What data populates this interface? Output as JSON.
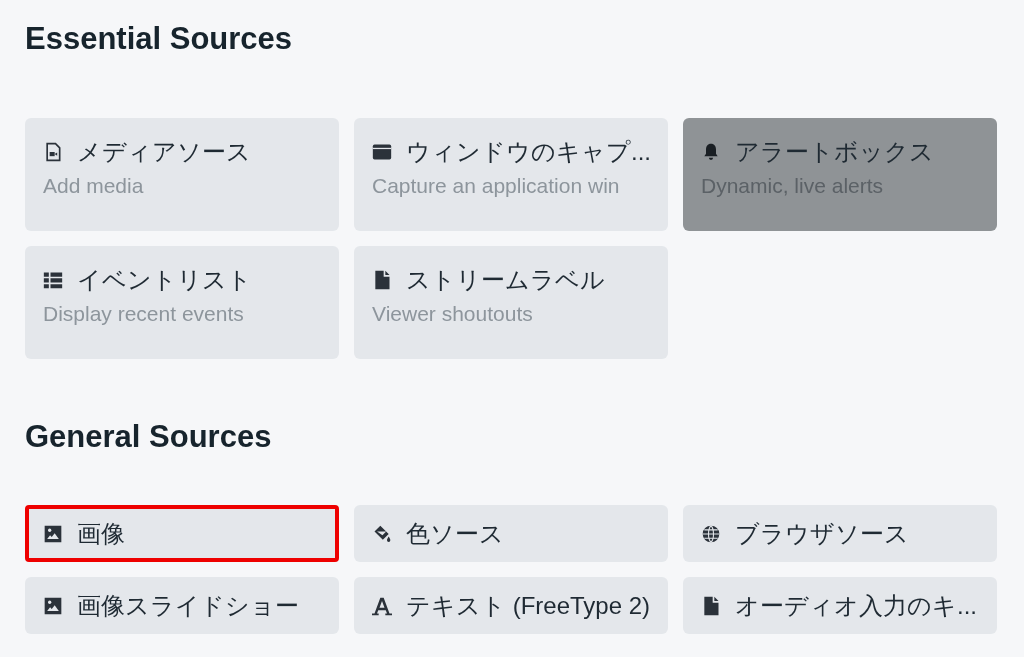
{
  "sections": [
    {
      "title": "Essential Sources",
      "kind": "tall",
      "items": [
        {
          "kind": "media",
          "label": "メディアソース",
          "description": "Add media",
          "highlighted": false,
          "marked": false
        },
        {
          "kind": "window",
          "label": "ウィンドウのキャプ...",
          "description": "Capture an application win",
          "highlighted": false,
          "marked": false
        },
        {
          "kind": "alert",
          "label": "アラートボックス",
          "description": "Dynamic, live alerts",
          "highlighted": true,
          "marked": false
        },
        {
          "kind": "list",
          "label": "イベントリスト",
          "description": "Display recent events",
          "highlighted": false,
          "marked": false
        },
        {
          "kind": "file",
          "label": "ストリームラベル",
          "description": "Viewer shoutouts",
          "highlighted": false,
          "marked": false
        }
      ]
    },
    {
      "title": "General Sources",
      "kind": "short",
      "items": [
        {
          "kind": "image",
          "label": "画像",
          "highlighted": false,
          "marked": true
        },
        {
          "kind": "color",
          "label": "色ソース",
          "highlighted": false,
          "marked": false
        },
        {
          "kind": "browser",
          "label": "ブラウザソース",
          "highlighted": false,
          "marked": false
        },
        {
          "kind": "image",
          "label": "画像スライドショー",
          "highlighted": false,
          "marked": false
        },
        {
          "kind": "text",
          "label": "テキスト (FreeType 2)",
          "highlighted": false,
          "marked": false
        },
        {
          "kind": "file",
          "label": "オーディオ入力のキ...",
          "highlighted": false,
          "marked": false
        }
      ]
    }
  ]
}
